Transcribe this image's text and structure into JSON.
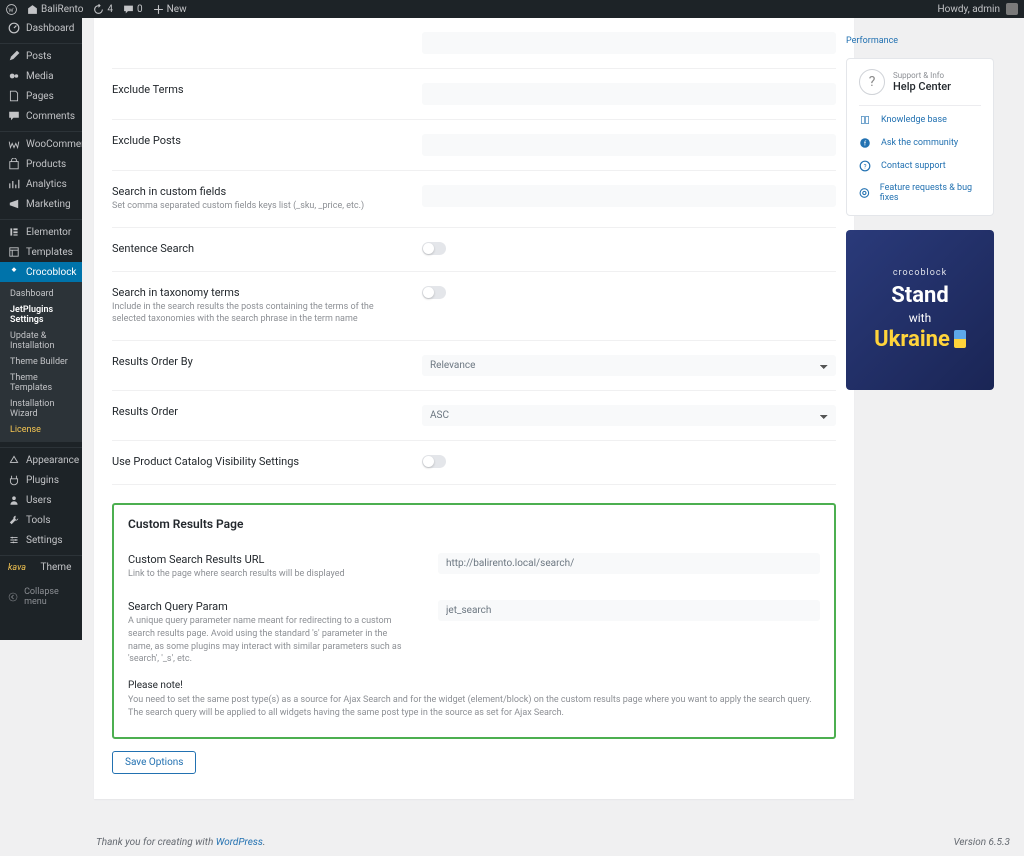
{
  "toolbar": {
    "site": "BaliRento",
    "updates": "4",
    "comments": "0",
    "new": "New",
    "howdy": "Howdy, admin"
  },
  "sidebar": {
    "items": [
      {
        "label": "Dashboard"
      },
      {
        "label": "Posts"
      },
      {
        "label": "Media"
      },
      {
        "label": "Pages"
      },
      {
        "label": "Comments"
      },
      {
        "label": "WooCommerce"
      },
      {
        "label": "Products"
      },
      {
        "label": "Analytics"
      },
      {
        "label": "Marketing"
      },
      {
        "label": "Elementor"
      },
      {
        "label": "Templates"
      },
      {
        "label": "Crocoblock"
      },
      {
        "label": "Appearance"
      },
      {
        "label": "Plugins"
      },
      {
        "label": "Users"
      },
      {
        "label": "Tools"
      },
      {
        "label": "Settings"
      }
    ],
    "submenu": [
      "Dashboard",
      "JetPlugins Settings",
      "Update & Installation",
      "Theme Builder",
      "Theme Templates",
      "Installation Wizard",
      "License"
    ],
    "kava": "Theme",
    "kava_brand": "kava",
    "collapse": "Collapse menu"
  },
  "top_link": "Performance",
  "settings": {
    "exclude_terms": "Exclude Terms",
    "exclude_posts": "Exclude Posts",
    "custom_fields": {
      "t": "Search in custom fields",
      "d": "Set comma separated custom fields keys list (_sku, _price, etc.)"
    },
    "sentence": "Sentence Search",
    "taxonomy": {
      "t": "Search in taxonomy terms",
      "d": "Include in the search results the posts containing the terms of the selected taxonomies with the search phrase in the term name"
    },
    "order_by": {
      "t": "Results Order By",
      "v": "Relevance"
    },
    "order": {
      "t": "Results Order",
      "v": "ASC"
    },
    "catalog_vis": "Use Product Catalog Visibility Settings"
  },
  "custom": {
    "title": "Custom Results Page",
    "url": {
      "t": "Custom Search Results URL",
      "d": "Link to the page where search results will be displayed",
      "v": "http://balirento.local/search/"
    },
    "param": {
      "t": "Search Query Param",
      "d": "A unique query parameter name meant for redirecting to a custom search results page. Avoid using the standard 's' parameter in the name, as some plugins may interact with similar parameters such as 'search', '_s', etc.",
      "v": "jet_search"
    },
    "note_t": "Please note!",
    "note": "You need to set the same post type(s) as a source for Ajax Search and for the widget (element/block) on the custom results page where you want to apply the search query. The search query will be applied to all widgets having the same post type in the source as set for Ajax Search."
  },
  "save": "Save Options",
  "help": {
    "sup": "Support & Info",
    "hc": "Help Center",
    "links": [
      "Knowledge base",
      "Ask the community",
      "Contact support",
      "Feature requests & bug fixes"
    ]
  },
  "banner": {
    "brand": "crocoblock",
    "l1": "Stand",
    "l2": "with",
    "l3": "Ukraine"
  },
  "footer": {
    "thank": "Thank you for creating with ",
    "wp": "WordPress",
    "ver": "Version 6.5.3"
  }
}
